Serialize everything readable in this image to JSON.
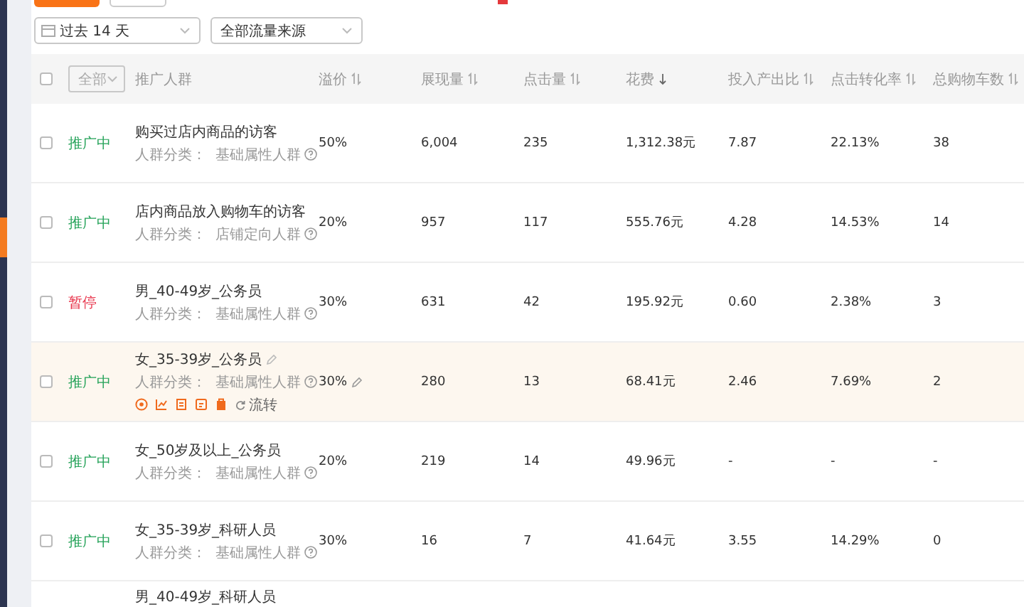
{
  "filters": {
    "date_range": "过去 14 天",
    "traffic_source": "全部流量来源"
  },
  "table": {
    "select_all_checked": false,
    "status_filter": "全部",
    "columns": [
      {
        "label": "推广人群",
        "kind": "plain"
      },
      {
        "label": "溢价",
        "kind": "sortable"
      },
      {
        "label": "展现量",
        "kind": "sortable"
      },
      {
        "label": "点击量",
        "kind": "sortable"
      },
      {
        "label": "花费",
        "kind": "sorted"
      },
      {
        "label": "投入产出比",
        "kind": "sortable"
      },
      {
        "label": "点击转化率",
        "kind": "sortable"
      },
      {
        "label": "总购物车数",
        "kind": "sortable"
      }
    ],
    "rows": [
      {
        "checked": false,
        "status": "推广中",
        "paused": false,
        "name": "购买过店内商品的访客",
        "category_label": "人群分类：",
        "category": "基础属性人群",
        "highlighted": false,
        "values": [
          "50%",
          "6,004",
          "235",
          "1,312.38元",
          "7.87",
          "22.13%",
          "38"
        ]
      },
      {
        "checked": false,
        "status": "推广中",
        "paused": false,
        "name": "店内商品放入购物车的访客",
        "category_label": "人群分类：",
        "category": "店铺定向人群",
        "highlighted": false,
        "values": [
          "20%",
          "957",
          "117",
          "555.76元",
          "4.28",
          "14.53%",
          "14"
        ]
      },
      {
        "checked": false,
        "status": "暂停",
        "paused": true,
        "name": "男_40-49岁_公务员",
        "category_label": "人群分类：",
        "category": "基础属性人群",
        "highlighted": false,
        "values": [
          "30%",
          "631",
          "42",
          "195.92元",
          "0.60",
          "2.38%",
          "3"
        ]
      },
      {
        "checked": false,
        "status": "推广中",
        "paused": false,
        "name": "女_35-39岁_公务员",
        "category_label": "人群分类：",
        "category": "基础属性人群",
        "highlighted": true,
        "action_label": "流转",
        "values": [
          "30%",
          "280",
          "13",
          "68.41元",
          "2.46",
          "7.69%",
          "2"
        ]
      },
      {
        "checked": false,
        "status": "推广中",
        "paused": false,
        "name": "女_50岁及以上_公务员",
        "category_label": "人群分类：",
        "category": "基础属性人群",
        "highlighted": false,
        "values": [
          "20%",
          "219",
          "14",
          "49.96元",
          "-",
          "-",
          "-"
        ]
      },
      {
        "checked": false,
        "status": "推广中",
        "paused": false,
        "name": "女_35-39岁_科研人员",
        "category_label": "人群分类：",
        "category": "基础属性人群",
        "highlighted": false,
        "values": [
          "30%",
          "16",
          "7",
          "41.64元",
          "3.55",
          "14.29%",
          "0"
        ]
      },
      {
        "name": "男_40-49岁_科研人员"
      }
    ]
  }
}
